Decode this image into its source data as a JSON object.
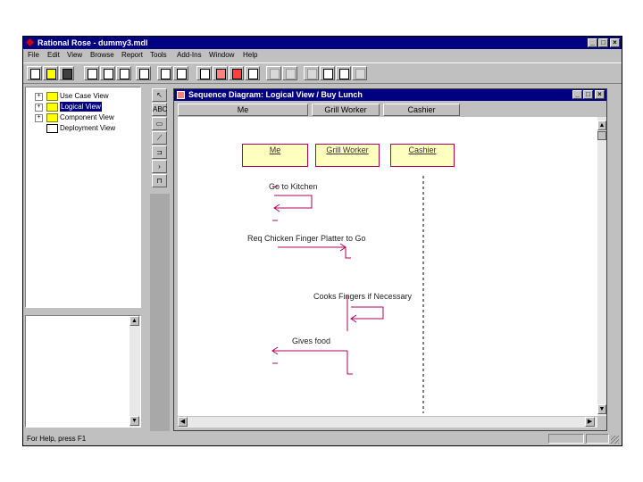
{
  "app": {
    "title": "Rational Rose - dummy3.mdl",
    "window_buttons": [
      "_",
      "□",
      "×"
    ]
  },
  "menu": [
    "File",
    "Edit",
    "View",
    "Browse",
    "Report",
    "Tools",
    "Add-Ins",
    "Window",
    "Help"
  ],
  "browser": {
    "items": [
      {
        "label": "Use Case View",
        "expander": "+"
      },
      {
        "label": "Logical View",
        "expander": "+"
      },
      {
        "label": "Component View",
        "expander": "+"
      },
      {
        "label": "Deployment View",
        "expander": ""
      }
    ],
    "selected_index": 1
  },
  "diagram_tools": [
    "↖",
    "ABC",
    "",
    "",
    "",
    "",
    ""
  ],
  "diagram": {
    "title": "Sequence Diagram: Logical View / Buy Lunch",
    "columns": [
      "Me",
      "Grill Worker",
      "Cashier"
    ],
    "objects": [
      "Me",
      "Grill Worker",
      "Cashier"
    ],
    "messages": [
      "Go to Kitchen",
      "Req Chicken Finger Platter to Go",
      "Cooks Fingers if Necessary",
      "Gives food"
    ]
  },
  "status": {
    "text": "For Help, press F1"
  },
  "colors": {
    "title_bar": "#000080",
    "chrome": "#c0c0c0",
    "object_fill": "#ffffc0",
    "message_line": "#b00060"
  }
}
